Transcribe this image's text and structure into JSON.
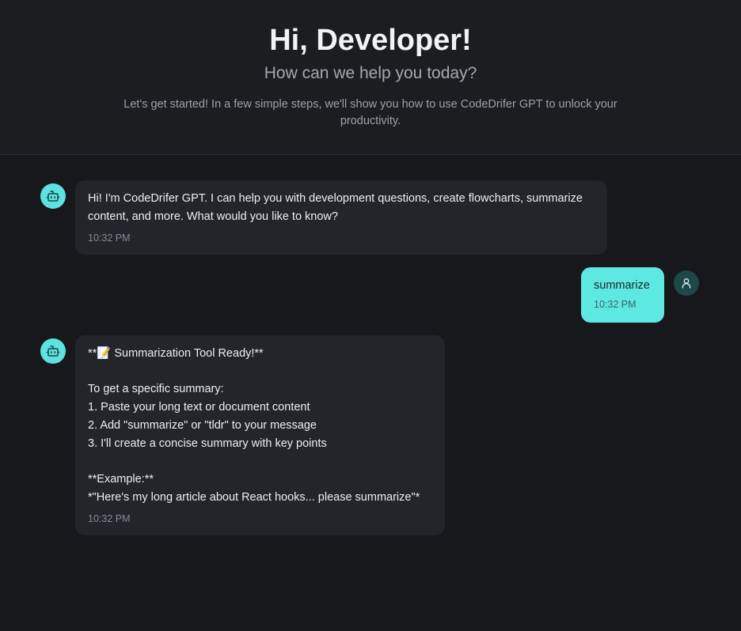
{
  "header": {
    "title": "Hi, Developer!",
    "subtitle": "How can we help you today?",
    "intro": "Let's get started! In a few simple steps, we'll show you how to use CodeDrifer GPT to unlock your productivity."
  },
  "messages": [
    {
      "role": "bot",
      "text": "Hi! I'm CodeDrifer GPT. I can help you with development questions, create flowcharts, summarize content, and more. What would you like to know?",
      "time": "10:32 PM",
      "avatar_icon": "robot-icon"
    },
    {
      "role": "user",
      "text": "summarize",
      "time": "10:32 PM",
      "avatar_icon": "user-icon"
    },
    {
      "role": "bot",
      "text": "**📝 Summarization Tool Ready!**\n\nTo get a specific summary:\n1. Paste your long text or document content\n2. Add \"summarize\" or \"tldr\" to your message\n3. I'll create a concise summary with key points\n\n**Example:**\n*\"Here's my long article about React hooks... please summarize\"*",
      "time": "10:32 PM",
      "avatar_icon": "robot-icon"
    }
  ],
  "colors": {
    "accent": "#5ee2df",
    "bot_bubble": "#23252b",
    "user_bubble": "#5ee8e2",
    "background": "#17181c"
  }
}
